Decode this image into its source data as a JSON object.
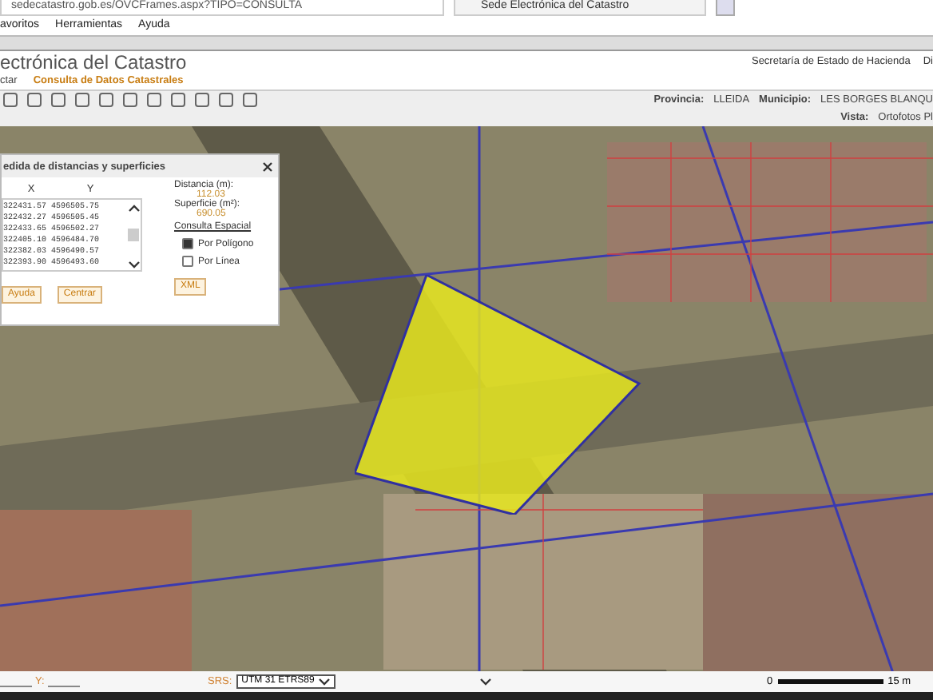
{
  "browser": {
    "address": "sedecatastro.gob.es/OVCFrames.aspx?TIPO=CONSULTA",
    "tab_title": "Sede Electrónica del Catastro",
    "menu": [
      "avoritos",
      "Herramientas",
      "Ayuda"
    ]
  },
  "header": {
    "title": "ectrónica del Catastro",
    "links": [
      "Secretaría de Estado de Hacienda",
      "Di"
    ]
  },
  "nav": {
    "items": [
      {
        "label": "ctar",
        "selected": false
      },
      {
        "label": "Consulta de Datos Catastrales",
        "selected": true
      }
    ]
  },
  "toolbar": {
    "provincia_label": "Provincia:",
    "provincia": "LLEIDA",
    "municipio_label": "Municipio:",
    "municipio": "LES BORGES BLANQU",
    "vista_label": "Vista:",
    "vista": "Ortofotos Pl"
  },
  "dialog": {
    "title": "edida de distancias y superficies",
    "columns": [
      "X",
      "Y"
    ],
    "rows": [
      [
        "322431.57",
        "4596505.75"
      ],
      [
        "322432.27",
        "4596505.45"
      ],
      [
        "322433.65",
        "4596502.27"
      ],
      [
        "322405.10",
        "4596484.70"
      ],
      [
        "322382.03",
        "4596490.57"
      ],
      [
        "322393.90",
        "4596493.60"
      ]
    ],
    "distance_label": "Distancia (m):",
    "distance": "112.03",
    "area_label": "Superficie (m²):",
    "area": "690.05",
    "query_label": "Consulta Espacial",
    "options": [
      {
        "label": "Por Polígono",
        "selected": true
      },
      {
        "label": "Por Línea",
        "selected": false
      }
    ],
    "buttons": [
      "Ayuda",
      "Centrar",
      "XML"
    ]
  },
  "status": {
    "y_label": "Y:",
    "srs_label": "SRS:",
    "srs": "UTM 31 ETRS89",
    "scale_start": "0",
    "scale_end": "15 m"
  }
}
